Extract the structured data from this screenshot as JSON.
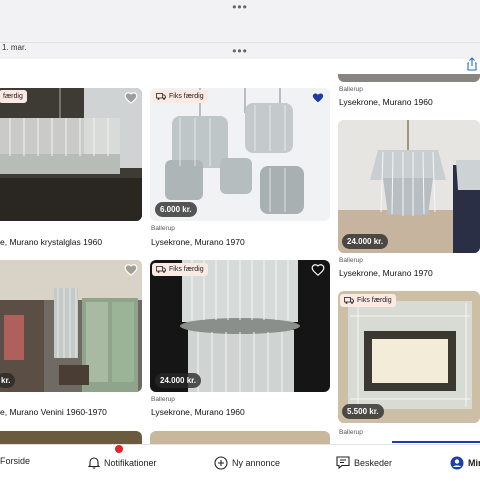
{
  "status": {
    "date": "1. mar."
  },
  "colors": {
    "accent": "#1b3ea8",
    "badge_bg": "#fbe9e4",
    "notification": "#e0252c"
  },
  "listings": [
    {
      "id": "c1",
      "badge": "færdig",
      "location": "",
      "title": "e, Murano krystalglas 1960",
      "price": "",
      "favorited": false
    },
    {
      "id": "c2",
      "badge": "Fiks færdig",
      "location": "Ballerup",
      "title": "Lysekrone, Murano 1970",
      "price": "6.000 kr.",
      "favorited": true
    },
    {
      "id": "c3",
      "badge": "",
      "location": "Ballerup",
      "title": "Lysekrone, Murano 1960",
      "price": "",
      "favorited": false
    },
    {
      "id": "c4",
      "badge": "",
      "location": "",
      "title": "e, Murano Venini 1960-1970",
      "price": "kr.",
      "favorited": false
    },
    {
      "id": "c5",
      "badge": "Fiks færdig",
      "location": "Ballerup",
      "title": "Lysekrone, Murano 1960",
      "price": "24.000 kr.",
      "favorited": false
    },
    {
      "id": "c6",
      "badge": "",
      "location": "Ballerup",
      "title": "Lysekrone, Murano 1970",
      "price": "24.000 kr.",
      "favorited": false
    },
    {
      "id": "c7",
      "badge": "Fiks færdig",
      "location": "Ballerup",
      "title": "",
      "price": "5.500 kr.",
      "favorited": false
    }
  ],
  "nav": {
    "home": "Forside",
    "notifications": "Notifikationer",
    "new_ad": "Ny annonce",
    "messages": "Beskeder",
    "mine": "Min"
  }
}
